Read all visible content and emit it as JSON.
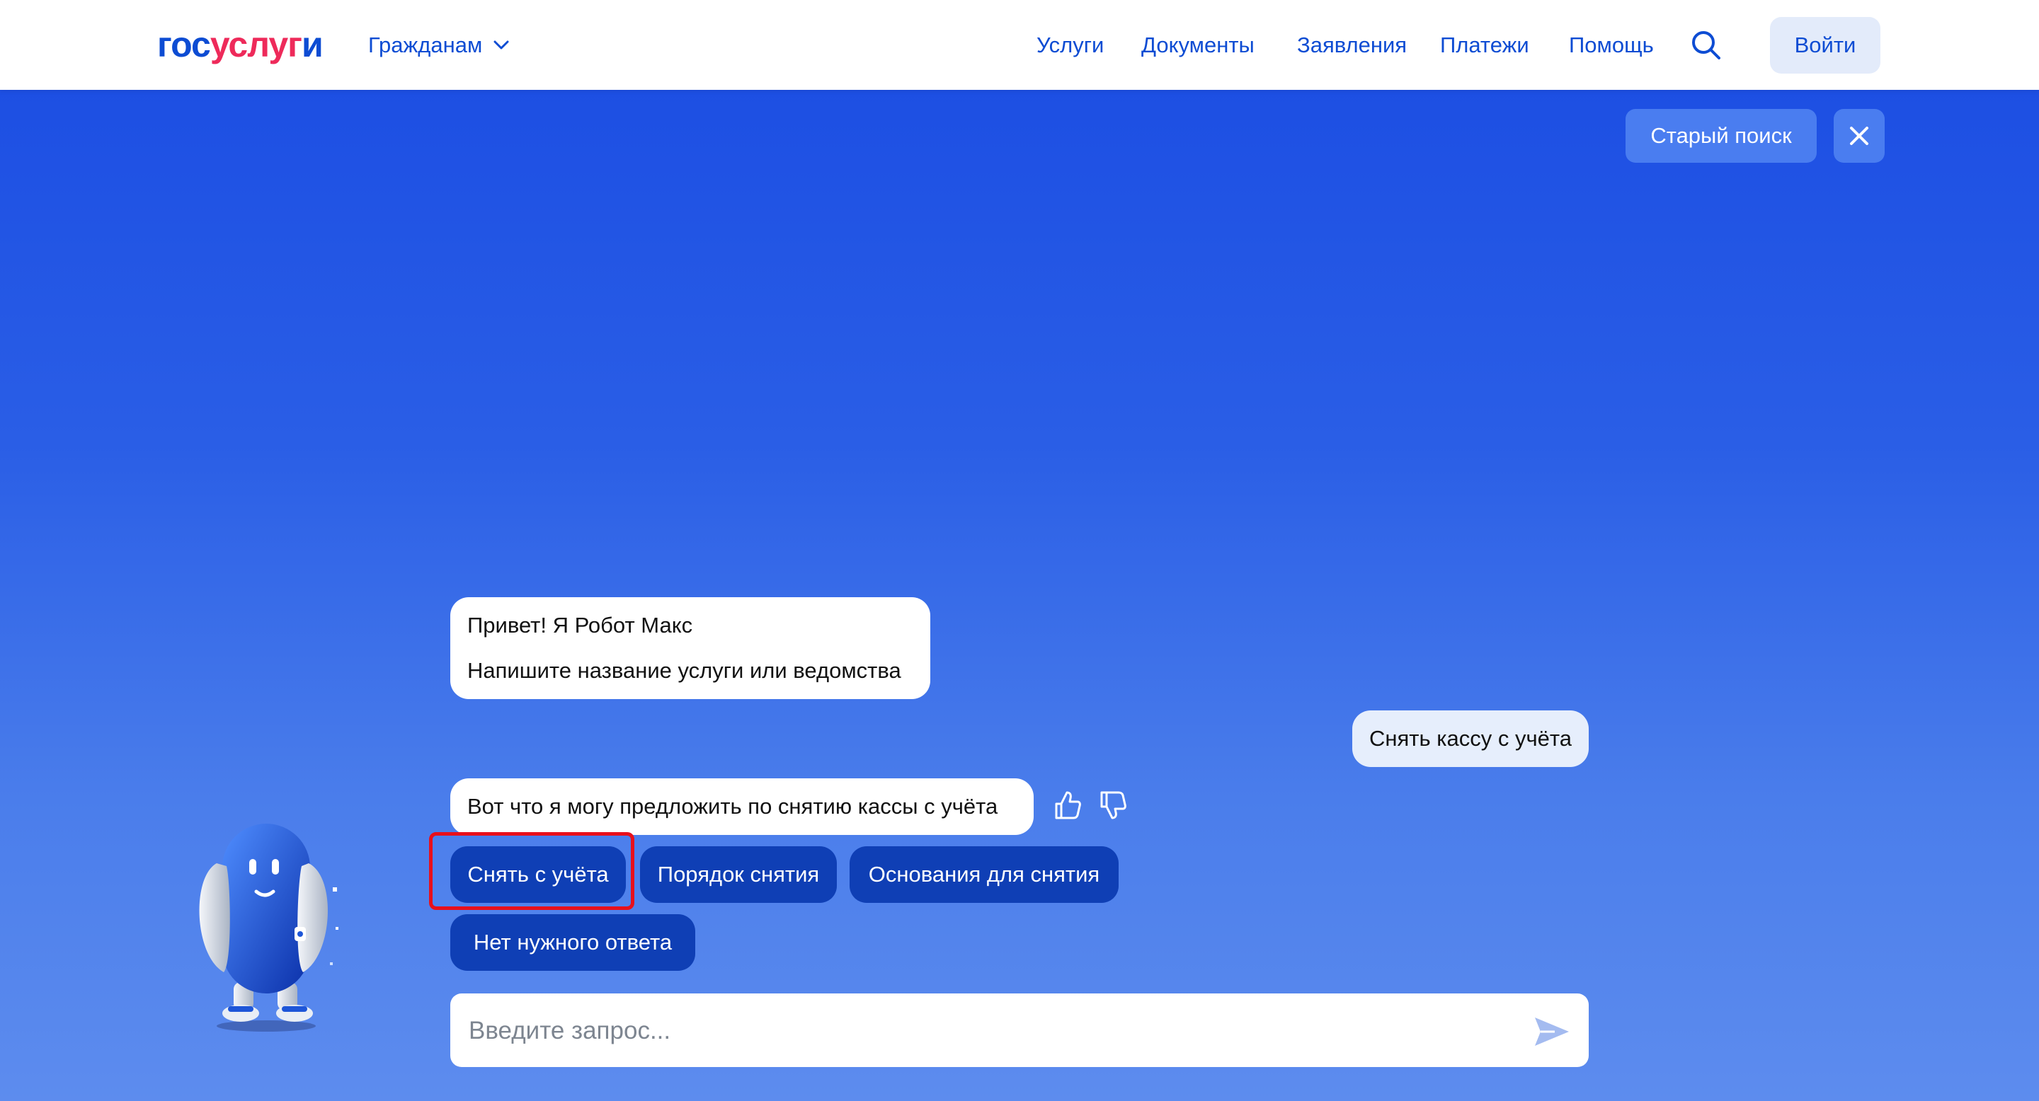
{
  "header": {
    "logo": {
      "part1": "гос",
      "part2": "услуг",
      "part3": "и"
    },
    "audience_label": "Гражданам",
    "nav": [
      "Услуги",
      "Документы",
      "Заявления",
      "Платежи",
      "Помощь"
    ],
    "login_label": "Войти"
  },
  "toolbar": {
    "old_search_label": "Старый поиск"
  },
  "chat": {
    "greeting_line1": "Привет! Я Робот Макс",
    "greeting_line2": "Напишите название услуги или ведомства",
    "user_message": "Снять кассу с учёта",
    "bot_reply": "Вот что я могу предложить по снятию кассы с учёта",
    "suggestions": [
      "Снять с учёта",
      "Порядок снятия",
      "Основания для снятия",
      "Нет нужного ответа"
    ]
  },
  "input": {
    "placeholder": "Введите запрос...",
    "value": ""
  },
  "colors": {
    "brand_blue": "#0d4cd3",
    "brand_red": "#ee2a5a",
    "chip_bg": "#0f3fb5",
    "highlight": "#e8101b"
  }
}
